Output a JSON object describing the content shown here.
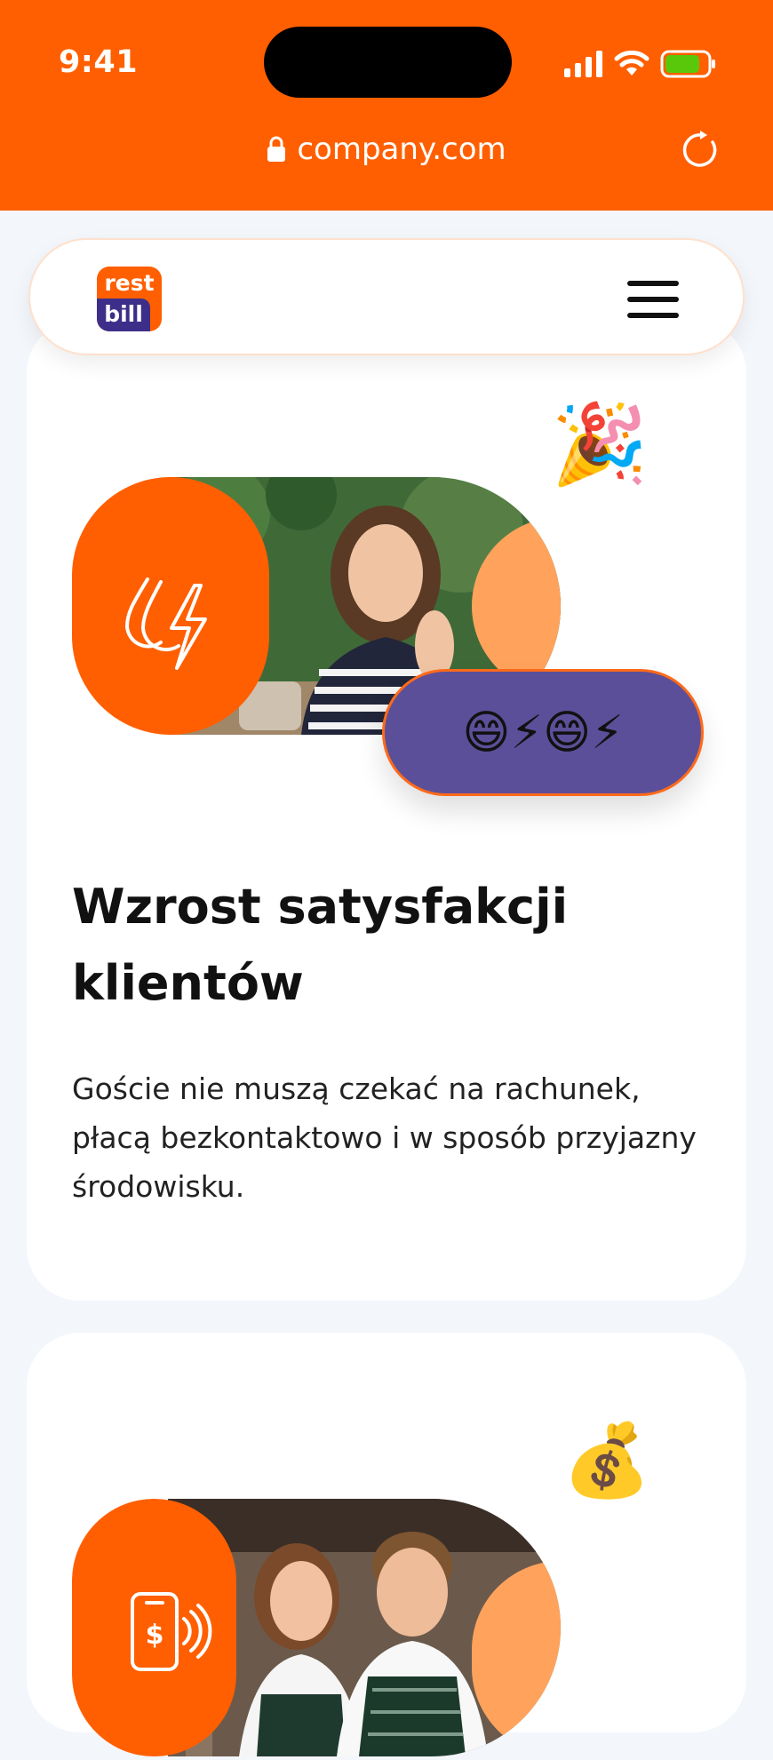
{
  "status_bar": {
    "time": "9:41"
  },
  "browser": {
    "url": "company.com"
  },
  "header": {
    "logo_top": "rest",
    "logo_bottom": "bill"
  },
  "colors": {
    "brand_orange": "#ff5f00",
    "brand_purple": "#5c4f99",
    "peach": "#ffa35c",
    "page_bg": "#f3f6fb"
  },
  "cards": [
    {
      "decor_emoji": "🎉",
      "feature_icon": "lightning-drop-icon",
      "reaction": "😄⚡😄⚡",
      "title": "Wzrost satysfakcji klientów",
      "description": "Goście nie muszą czekać na rachunek, płacą bezkontaktowo i w sposób przyjazny środowisku."
    },
    {
      "decor_emoji": "💰",
      "feature_icon": "phone-dollar-contactless-icon"
    }
  ]
}
